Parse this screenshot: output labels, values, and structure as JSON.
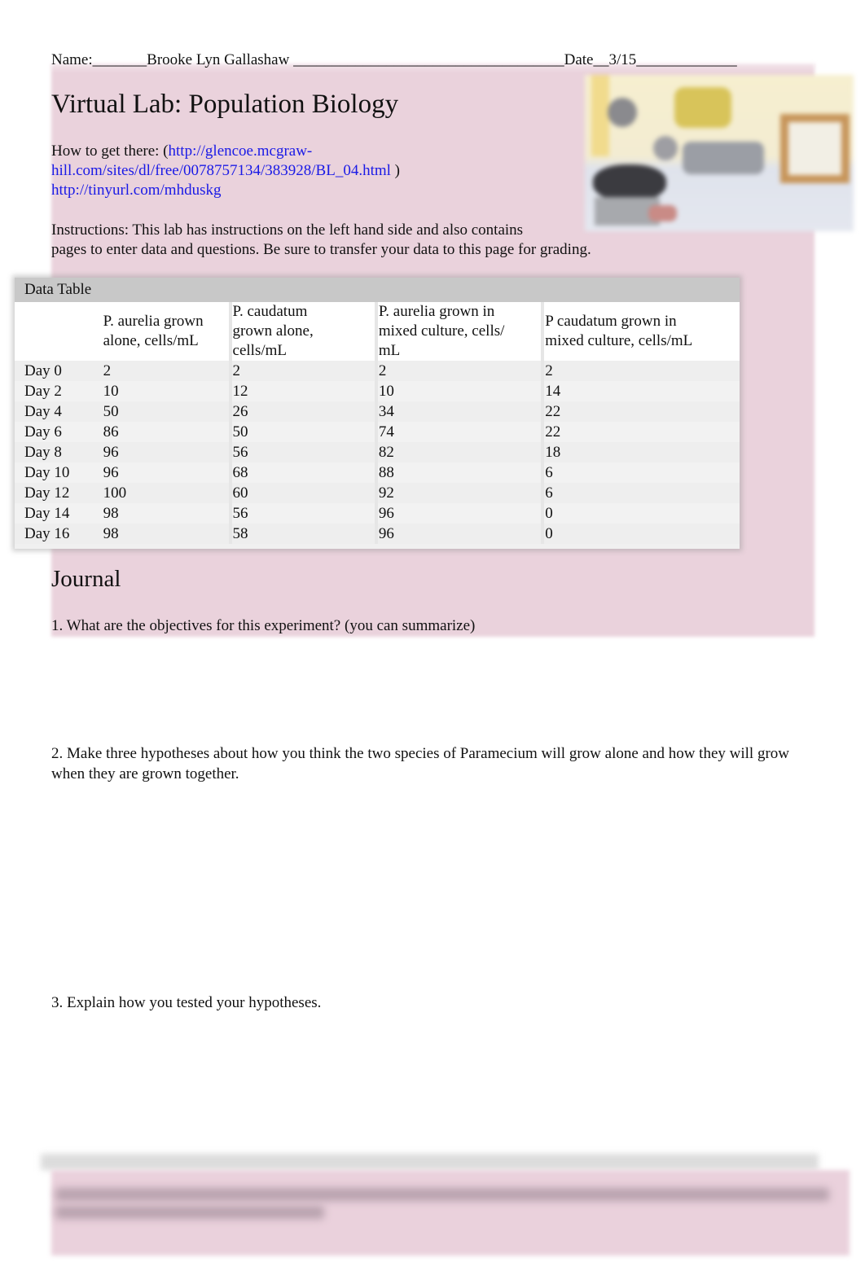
{
  "header": {
    "name_label": "Name:",
    "name_blank_before": "_______",
    "student_name": "Brooke Lyn Gallashaw",
    "name_blank_after": " ___________________________________",
    "date_label": "Date",
    "date_blank_before": "__",
    "date_value": "3/15",
    "date_blank_after": "_____________"
  },
  "title": "Virtual Lab: Population Biology",
  "how_to": {
    "label": "How to get there: (",
    "link1": "http://glencoe.mcgraw-hill.com/sites/dl/free/0078757134/383928/BL_04.html",
    "link1_line1": "http://glencoe.mcgraw-",
    "link1_line2": "hill.com/sites/dl/free/0078757134/383928/BL_04.html",
    "close_paren": " )",
    "link2": "http://tinyurl.com/mhduskg"
  },
  "instructions": {
    "line1": "Instructions: This lab has instructions on the left hand side and also contains",
    "line2": "pages to enter data and questions. Be sure to transfer your data to this page for grading."
  },
  "data_table": {
    "caption": "Data Table",
    "columns": [
      "",
      "P. aurelia grown alone, cells/mL",
      "P. caudatum grown alone, cells/mL",
      "P. aurelia  grown in mixed culture, cells/ mL",
      "P caudatum  grown in mixed culture, cells/mL"
    ],
    "rows": [
      {
        "day": "Day 0",
        "values": [
          "2",
          "2",
          "2",
          "2"
        ]
      },
      {
        "day": "Day 2",
        "values": [
          "10",
          "12",
          "10",
          "14"
        ]
      },
      {
        "day": "Day 4",
        "values": [
          "50",
          "26",
          "34",
          "22"
        ]
      },
      {
        "day": "Day 6",
        "values": [
          "86",
          "50",
          "74",
          "22"
        ]
      },
      {
        "day": "Day 8",
        "values": [
          "96",
          "56",
          "82",
          "18"
        ]
      },
      {
        "day": "Day 10",
        "values": [
          "96",
          "68",
          "88",
          "6"
        ]
      },
      {
        "day": "Day 12",
        "values": [
          "100",
          "60",
          "92",
          "6"
        ]
      },
      {
        "day": "Day 14",
        "values": [
          "98",
          "56",
          "96",
          "0"
        ]
      },
      {
        "day": "Day 16",
        "values": [
          "98",
          "58",
          "96",
          "0"
        ]
      }
    ]
  },
  "journal": {
    "heading": "Journal",
    "questions": [
      "1. What are the objectives for this experiment? (you can summarize)",
      "2. Make three  hypotheses about how you think the two species of Paramecium  will grow alone and how they will grow when they are grown together.",
      "3. Explain how you tested your hypotheses."
    ]
  },
  "colors": {
    "page_highlight": "#ead2dc",
    "link": "#1a1ae6",
    "table_caption_bg": "#c8c8c8"
  }
}
